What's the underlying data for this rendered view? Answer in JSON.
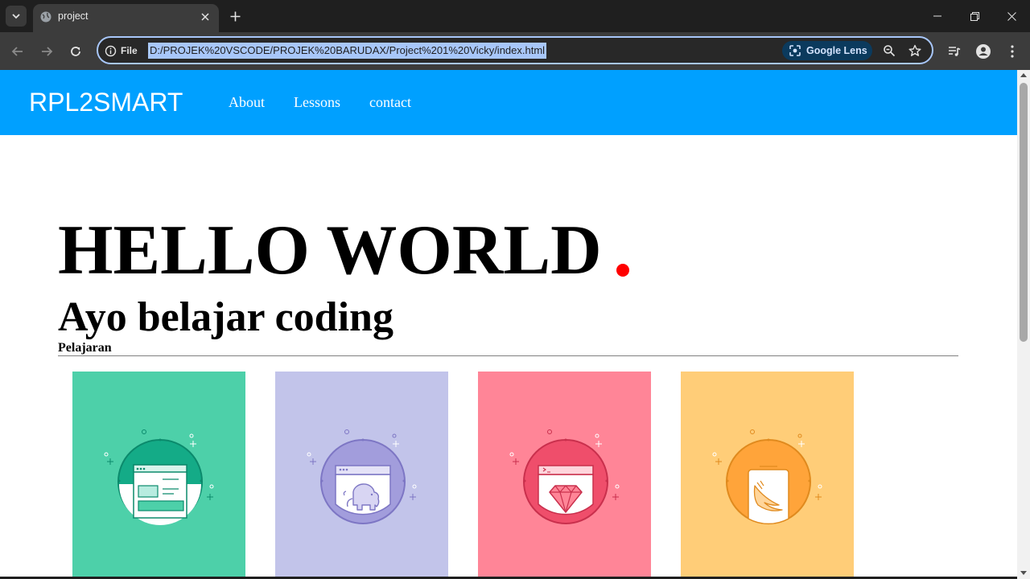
{
  "browser": {
    "tab_title": "project",
    "site_info_label": "File",
    "url": "D:/PROJEK%20VSCODE/PROJEK%20BARUDAX/Project%201%20Vicky/index.html",
    "lens_label": "Google Lens",
    "icons": {
      "tab_search": "chevron-down-icon",
      "favicon": "globe-icon",
      "tab_close": "close-icon",
      "new_tab": "plus-icon",
      "minimize": "minimize-icon",
      "restore": "restore-icon",
      "close_window": "close-icon",
      "back": "arrow-left-icon",
      "forward": "arrow-right-icon",
      "reload": "reload-icon",
      "info": "info-icon",
      "lens": "lens-icon",
      "zoom": "zoom-icon",
      "bookmark": "star-icon",
      "media": "media-icon",
      "profile": "profile-icon",
      "menu": "kebab-menu-icon"
    }
  },
  "site": {
    "brand": "RPL2SMART",
    "nav": [
      {
        "label": "About"
      },
      {
        "label": "Lessons"
      },
      {
        "label": "contact"
      }
    ],
    "hero_title": "HELLO WORLD",
    "hero_subtitle": "Ayo belajar coding",
    "section_label": "Pelajaran",
    "accent_color": "#ff0000",
    "nav_color": "#00a0ff",
    "cards": [
      {
        "name": "web-layout",
        "icon": "browser-window-icon",
        "bg": "#4dd0a9",
        "circle": "#14ab87"
      },
      {
        "name": "php",
        "icon": "elephant-icon",
        "bg": "#c2c4ea",
        "circle": "#a29ddc"
      },
      {
        "name": "ruby",
        "icon": "ruby-gem-icon",
        "bg": "#ff8597",
        "circle": "#ef4e6b"
      },
      {
        "name": "swift",
        "icon": "swift-bird-icon",
        "bg": "#ffcd78",
        "circle": "#ffa43a"
      }
    ]
  }
}
